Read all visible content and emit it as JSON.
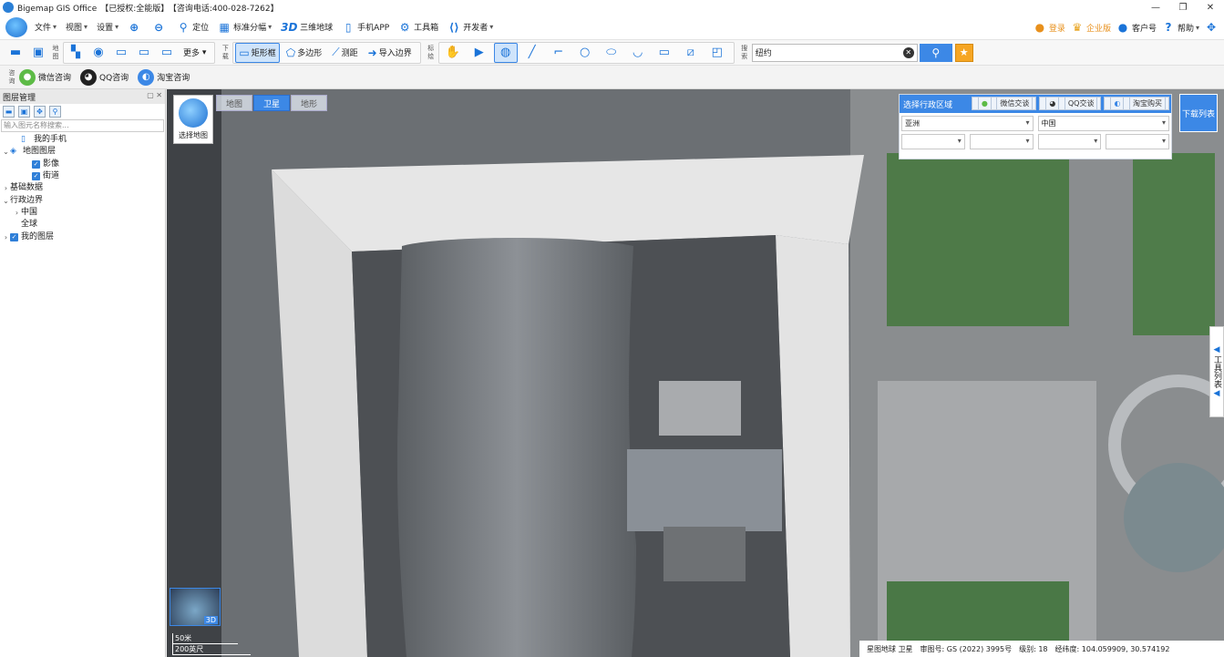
{
  "app": {
    "title": "Bigemap GIS Office",
    "license": "【已授权:全能版】",
    "hotline": "【咨询电话:400-028-7262】"
  },
  "menu": {
    "items": [
      {
        "label": "文件",
        "icon": "none",
        "dropdown": true
      },
      {
        "label": "视图",
        "icon": "none",
        "dropdown": true
      },
      {
        "label": "设置",
        "icon": "none",
        "dropdown": true
      },
      {
        "label": "",
        "icon": "zoom-in-icon"
      },
      {
        "label": "",
        "icon": "zoom-out-icon"
      },
      {
        "label": "定位",
        "icon": "location-pin-icon"
      },
      {
        "label": "标准分幅",
        "icon": "grid-icon",
        "dropdown": true
      },
      {
        "label": "三维地球",
        "icon": "3d-icon"
      },
      {
        "label": "手机APP",
        "icon": "phone-icon"
      },
      {
        "label": "工具箱",
        "icon": "gear-icon"
      },
      {
        "label": "开发者",
        "icon": "code-icon",
        "dropdown": true
      }
    ],
    "right": [
      {
        "label": "登录",
        "icon": "user-icon"
      },
      {
        "label": "企业版",
        "icon": "crown-icon"
      },
      {
        "label": "客户号",
        "icon": "customer-icon"
      },
      {
        "label": "帮助",
        "icon": "help-icon"
      }
    ]
  },
  "toolbar": {
    "map_label": "地图",
    "download_label": "下载",
    "draw_label": "标绘",
    "search_label": "搜索",
    "more": "更多",
    "rect_frame": "矩形框",
    "polygon": "多边形",
    "measure": "测距",
    "import_boundary": "导入边界",
    "search_value": "纽约"
  },
  "consult": {
    "label": "咨询",
    "wechat": "微信咨询",
    "qq": "QQ咨询",
    "taobao": "淘宝咨询"
  },
  "layers_panel": {
    "title": "图层管理",
    "search_placeholder": "输入图元名称搜索...",
    "items": [
      {
        "label": "我的手机",
        "level": 1,
        "arrow": "",
        "checked": null,
        "icon": "phone-icon"
      },
      {
        "label": "地图图层",
        "level": 0,
        "arrow": "v",
        "checked": null,
        "icon": "layers-icon"
      },
      {
        "label": "影像",
        "level": 2,
        "arrow": "",
        "checked": true,
        "icon": "none"
      },
      {
        "label": "街道",
        "level": 2,
        "arrow": "",
        "checked": true,
        "icon": "none"
      },
      {
        "label": "基础数据",
        "level": 0,
        "arrow": ">",
        "checked": null,
        "icon": "none"
      },
      {
        "label": "行政边界",
        "level": 0,
        "arrow": "v",
        "checked": null,
        "icon": "none"
      },
      {
        "label": "中国",
        "level": 1,
        "arrow": ">",
        "checked": null,
        "icon": "none"
      },
      {
        "label": "全球",
        "level": 1,
        "arrow": "",
        "checked": null,
        "icon": "none"
      },
      {
        "label": "我的图层",
        "level": 0,
        "arrow": ">",
        "checked": true,
        "icon": "none"
      }
    ]
  },
  "map": {
    "choose_map": "选择地图",
    "tabs": [
      "地图",
      "卫星",
      "地形"
    ],
    "active_tab": "卫星",
    "admin_panel": {
      "title": "选择行政区域",
      "wechat": "微信交谈",
      "qq": "QQ交谈",
      "taobao": "淘宝购买",
      "continent": "亚洲",
      "country": "中国"
    },
    "download_list": "下载列表",
    "tools_list": "工具列表",
    "globe_label": "3D",
    "scale_top": "50米",
    "scale_bottom": "200英尺",
    "status": {
      "source": "星图地球 卫星",
      "approval": "审图号: GS (2022) 3995号",
      "level": "级别: 18",
      "coords": "经纬度: 104.059909, 30.574192"
    }
  },
  "colors": {
    "accent": "#3c88e6",
    "roof": "#e8e8e8",
    "grass": "#4e7a48"
  }
}
